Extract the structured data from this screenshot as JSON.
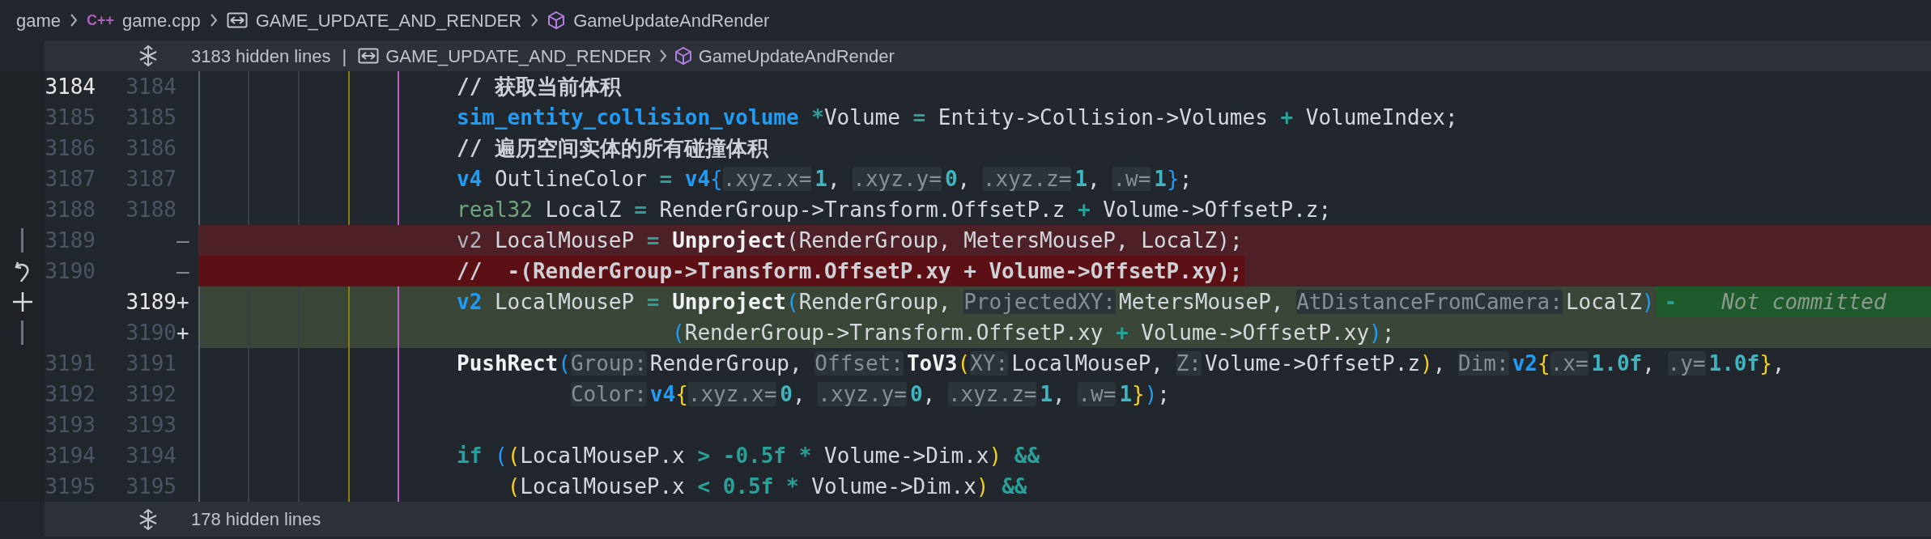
{
  "breadcrumb": [
    {
      "kind": "folder",
      "label": "game"
    },
    {
      "kind": "file",
      "badge": "C++",
      "label": "game.cpp"
    },
    {
      "kind": "macro",
      "label": "GAME_UPDATE_AND_RENDER"
    },
    {
      "kind": "function",
      "label": "GameUpdateAndRender"
    }
  ],
  "fold_top": {
    "text": "3183 hidden lines",
    "separator": "|",
    "crumbs": [
      {
        "kind": "macro",
        "label": "GAME_UPDATE_AND_RENDER"
      },
      {
        "kind": "function",
        "label": "GameUpdateAndRender"
      }
    ]
  },
  "rows": [
    {
      "kind": "context",
      "old": {
        "number": "3184",
        "highlighted": true
      },
      "new": {
        "number": "3184",
        "highlighted": false
      },
      "strong": false,
      "code": [
        {
          "kind": "comment",
          "text": "// 获取当前体积"
        }
      ]
    },
    {
      "kind": "context",
      "old": {
        "number": "3185",
        "highlighted": false
      },
      "new": {
        "number": "3185",
        "highlighted": false
      },
      "strong": false,
      "code": [
        {
          "kind": "type",
          "text": "sim_entity_collision_volume "
        },
        {
          "kind": "operator",
          "text": "*"
        },
        {
          "kind": "plain",
          "text": "Volume "
        },
        {
          "kind": "operator",
          "text": "="
        },
        {
          "kind": "plain",
          "text": " Entity->Collision->Volumes "
        },
        {
          "kind": "operator",
          "text": "+"
        },
        {
          "kind": "plain",
          "text": " VolumeIndex;"
        }
      ]
    },
    {
      "kind": "context",
      "old": {
        "number": "3186",
        "highlighted": false
      },
      "new": {
        "number": "3186",
        "highlighted": false
      },
      "strong": false,
      "code": [
        {
          "kind": "comment",
          "text": "// 遍历空间实体的所有碰撞体积"
        }
      ]
    },
    {
      "kind": "context",
      "old": {
        "number": "3187",
        "highlighted": false
      },
      "new": {
        "number": "3187",
        "highlighted": false
      },
      "strong": false,
      "code": [
        {
          "kind": "type",
          "text": "v4"
        },
        {
          "kind": "plain",
          "text": " OutlineColor "
        },
        {
          "kind": "operator",
          "text": "= "
        },
        {
          "kind": "type",
          "text": "v4"
        },
        {
          "kind": "bracket",
          "text": "{"
        },
        {
          "kind": "hint",
          "text": ".xyz.x="
        },
        {
          "kind": "number",
          "text": "1"
        },
        {
          "kind": "plain",
          "text": ", "
        },
        {
          "kind": "hint",
          "text": ".xyz.y="
        },
        {
          "kind": "number",
          "text": "0"
        },
        {
          "kind": "plain",
          "text": ", "
        },
        {
          "kind": "hint",
          "text": ".xyz.z="
        },
        {
          "kind": "number",
          "text": "1"
        },
        {
          "kind": "plain",
          "text": ", "
        },
        {
          "kind": "hint",
          "text": ".w="
        },
        {
          "kind": "number",
          "text": "1"
        },
        {
          "kind": "bracket",
          "text": "}"
        },
        {
          "kind": "plain",
          "text": ";"
        }
      ]
    },
    {
      "kind": "context",
      "old": {
        "number": "3188",
        "highlighted": false
      },
      "new": {
        "number": "3188",
        "highlighted": false
      },
      "strong": false,
      "code": [
        {
          "kind": "builtin",
          "text": "real32"
        },
        {
          "kind": "plain",
          "text": " LocalZ "
        },
        {
          "kind": "operator",
          "text": "="
        },
        {
          "kind": "plain",
          "text": " RenderGroup->Transform.OffsetP.z "
        },
        {
          "kind": "operator",
          "text": "+"
        },
        {
          "kind": "plain",
          "text": " Volume->OffsetP.z;"
        }
      ]
    },
    {
      "kind": "removed",
      "old": {
        "number": "3189",
        "highlighted": false
      },
      "sign": "—",
      "gutter_icon": {
        "kind": "bar"
      },
      "strong": false,
      "code": [
        {
          "kind": "dim",
          "text": "v2"
        },
        {
          "kind": "plain",
          "text": " LocalMouseP "
        },
        {
          "kind": "operator",
          "text": "= "
        },
        {
          "kind": "function",
          "text": "Unproject"
        },
        {
          "kind": "plain",
          "text": "(RenderGroup, MetersMouseP, LocalZ);"
        }
      ]
    },
    {
      "kind": "removed",
      "old": {
        "number": "3190",
        "highlighted": false
      },
      "sign": "—",
      "gutter_icon": {
        "kind": "revert"
      },
      "strong": true,
      "code": [
        {
          "kind": "comment",
          "text": "//  -(RenderGroup->Transform.OffsetP.xy + Volume->OffsetP.xy);"
        }
      ]
    },
    {
      "kind": "added",
      "new": {
        "number": "3189",
        "highlighted": true
      },
      "sign": "+",
      "gutter_icon": {
        "kind": "plus"
      },
      "strong": false,
      "code": [
        {
          "kind": "type",
          "text": "v2"
        },
        {
          "kind": "plain",
          "text": " LocalMouseP "
        },
        {
          "kind": "operator",
          "text": "= "
        },
        {
          "kind": "function",
          "text": "Unproject"
        },
        {
          "kind": "bracket",
          "text": "("
        },
        {
          "kind": "plain",
          "text": "RenderGroup, "
        },
        {
          "kind": "hint",
          "text": "ProjectedXY:"
        },
        {
          "kind": "plain",
          "text": "MetersMouseP, "
        },
        {
          "kind": "hint",
          "text": "AtDistanceFromCamera:"
        },
        {
          "kind": "plain",
          "text": "LocalZ"
        },
        {
          "kind": "bracket",
          "text": ")"
        }
      ],
      "annotation": {
        "dash": "-",
        "text": "Not committed"
      }
    },
    {
      "kind": "added",
      "new": {
        "number": "3190",
        "highlighted": false
      },
      "sign": "+",
      "gutter_icon": {
        "kind": "bar"
      },
      "strong": false,
      "code": [
        {
          "kind": "bracket",
          "text": "                 ("
        },
        {
          "kind": "plain",
          "text": "RenderGroup->Transform.OffsetP.xy "
        },
        {
          "kind": "operator",
          "text": "+"
        },
        {
          "kind": "plain",
          "text": " Volume->OffsetP.xy"
        },
        {
          "kind": "bracket",
          "text": ")"
        },
        {
          "kind": "plain",
          "text": ";"
        }
      ]
    },
    {
      "kind": "context",
      "old": {
        "number": "3191",
        "highlighted": false
      },
      "new": {
        "number": "3191",
        "highlighted": false
      },
      "strong": false,
      "code": [
        {
          "kind": "function",
          "text": "PushRect"
        },
        {
          "kind": "bracket",
          "text": "("
        },
        {
          "kind": "hint",
          "text": "Group:"
        },
        {
          "kind": "plain",
          "text": "RenderGroup, "
        },
        {
          "kind": "hint",
          "text": "Offset:"
        },
        {
          "kind": "function",
          "text": "ToV3"
        },
        {
          "kind": "paren",
          "text": "("
        },
        {
          "kind": "hint",
          "text": "XY:"
        },
        {
          "kind": "plain",
          "text": "LocalMouseP, "
        },
        {
          "kind": "hint",
          "text": "Z:"
        },
        {
          "kind": "plain",
          "text": "Volume->OffsetP.z"
        },
        {
          "kind": "paren",
          "text": ")"
        },
        {
          "kind": "plain",
          "text": ", "
        },
        {
          "kind": "hint",
          "text": "Dim:"
        },
        {
          "kind": "type",
          "text": "v2"
        },
        {
          "kind": "paren",
          "text": "{"
        },
        {
          "kind": "hint",
          "text": ".x="
        },
        {
          "kind": "number",
          "text": "1.0f"
        },
        {
          "kind": "plain",
          "text": ", "
        },
        {
          "kind": "hint",
          "text": ".y="
        },
        {
          "kind": "number",
          "text": "1.0f"
        },
        {
          "kind": "paren",
          "text": "}"
        },
        {
          "kind": "plain",
          "text": ","
        }
      ]
    },
    {
      "kind": "context",
      "old": {
        "number": "3192",
        "highlighted": false
      },
      "new": {
        "number": "3192",
        "highlighted": false
      },
      "strong": false,
      "code": [
        {
          "kind": "hint",
          "text": "         Color:"
        },
        {
          "kind": "type",
          "text": "v4"
        },
        {
          "kind": "paren",
          "text": "{"
        },
        {
          "kind": "hint",
          "text": ".xyz.x="
        },
        {
          "kind": "number",
          "text": "0"
        },
        {
          "kind": "plain",
          "text": ", "
        },
        {
          "kind": "hint",
          "text": ".xyz.y="
        },
        {
          "kind": "number",
          "text": "0"
        },
        {
          "kind": "plain",
          "text": ", "
        },
        {
          "kind": "hint",
          "text": ".xyz.z="
        },
        {
          "kind": "number",
          "text": "1"
        },
        {
          "kind": "plain",
          "text": ", "
        },
        {
          "kind": "hint",
          "text": ".w="
        },
        {
          "kind": "number",
          "text": "1"
        },
        {
          "kind": "paren",
          "text": "}"
        },
        {
          "kind": "bracket",
          "text": ")"
        },
        {
          "kind": "plain",
          "text": ";"
        }
      ]
    },
    {
      "kind": "context",
      "old": {
        "number": "3193",
        "highlighted": false
      },
      "new": {
        "number": "3193",
        "highlighted": false
      },
      "strong": false
    },
    {
      "kind": "context",
      "old": {
        "number": "3194",
        "highlighted": false
      },
      "new": {
        "number": "3194",
        "highlighted": false
      },
      "strong": false,
      "code": [
        {
          "kind": "keyword",
          "text": "if "
        },
        {
          "kind": "bracket",
          "text": "("
        },
        {
          "kind": "paren",
          "text": "("
        },
        {
          "kind": "plain",
          "text": "LocalMouseP.x "
        },
        {
          "kind": "operator",
          "text": "> -0.5f * "
        },
        {
          "kind": "plain",
          "text": "Volume->Dim.x"
        },
        {
          "kind": "paren",
          "text": ")"
        },
        {
          "kind": "operator",
          "text": " &&"
        }
      ]
    },
    {
      "kind": "context",
      "old": {
        "number": "3195",
        "highlighted": false
      },
      "new": {
        "number": "3195",
        "highlighted": false
      },
      "strong": false,
      "code": [
        {
          "kind": "paren",
          "text": "    ("
        },
        {
          "kind": "plain",
          "text": "LocalMouseP.x "
        },
        {
          "kind": "operator",
          "text": "< 0.5f * "
        },
        {
          "kind": "plain",
          "text": "Volume->Dim.x"
        },
        {
          "kind": "paren",
          "text": ")"
        },
        {
          "kind": "operator",
          "text": " &&"
        }
      ]
    }
  ],
  "fold_bottom": {
    "text": "178 hidden lines"
  }
}
